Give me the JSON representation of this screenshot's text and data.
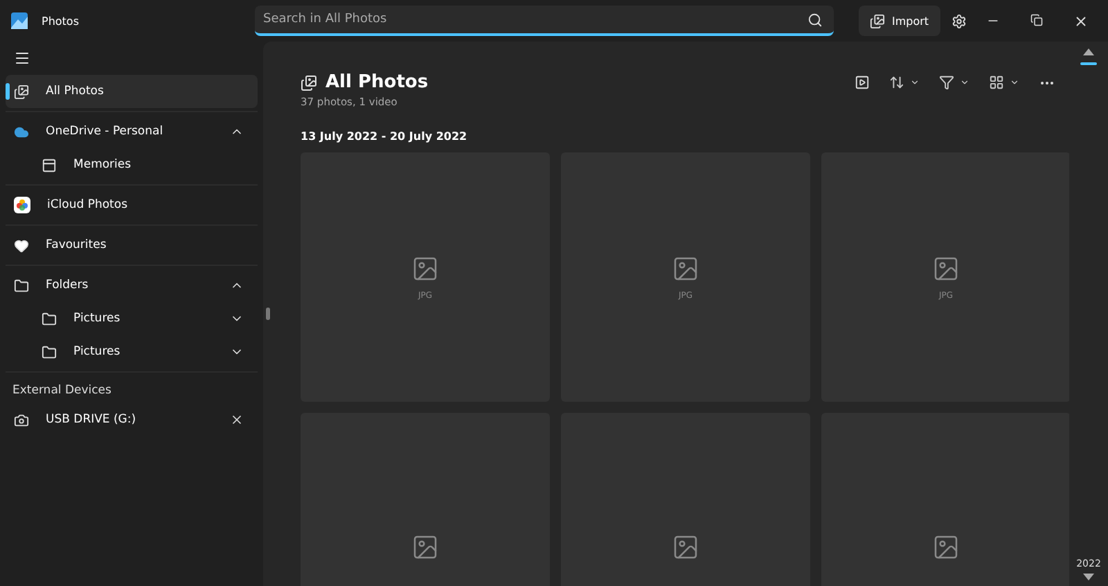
{
  "window": {
    "title": "Photos"
  },
  "search": {
    "placeholder": "Search in All Photos"
  },
  "import_button": {
    "label": "Import"
  },
  "sidebar": {
    "items": [
      {
        "kind": "item",
        "label": "All Photos",
        "selected": true
      },
      {
        "kind": "divider"
      },
      {
        "kind": "item",
        "label": "OneDrive - Personal",
        "selected": false,
        "expanded": true,
        "children": [
          {
            "label": "Memories",
            "selected": false
          }
        ]
      },
      {
        "kind": "divider"
      },
      {
        "kind": "item",
        "label": "iCloud Photos",
        "selected": false
      },
      {
        "kind": "divider"
      },
      {
        "kind": "item",
        "label": "Favourites",
        "selected": false
      },
      {
        "kind": "divider"
      },
      {
        "kind": "item",
        "label": "Folders",
        "selected": false,
        "expanded": true,
        "children": [
          {
            "label": "Pictures",
            "selected": false,
            "expanded": false
          },
          {
            "label": "Pictures",
            "selected": false,
            "expanded": false
          }
        ]
      },
      {
        "kind": "divider"
      },
      {
        "kind": "heading",
        "label": "External Devices"
      },
      {
        "kind": "item",
        "label": "USB DRIVE (G:)",
        "selected": false,
        "removable": true
      }
    ]
  },
  "main": {
    "title": "All Photos",
    "subtitle": "37 photos, 1 video",
    "groups": [
      {
        "date": "13 July 2022 - 20 July 2022",
        "tiles": [
          {
            "kind": "full",
            "label": "JPG"
          },
          {
            "kind": "full",
            "label": "JPG"
          },
          {
            "kind": "full",
            "label": "JPG"
          },
          {
            "kind": "cut"
          },
          {
            "kind": "cut"
          },
          {
            "kind": "cut"
          }
        ]
      }
    ]
  },
  "timeline": {
    "year": "2022"
  }
}
